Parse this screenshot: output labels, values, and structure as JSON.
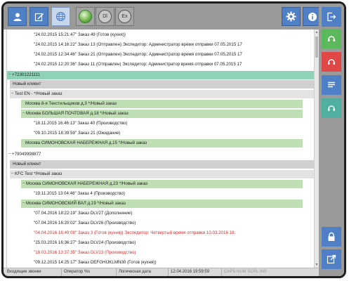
{
  "toolbar": {
    "badge_dl": "Dl",
    "badge_ex": "Ex"
  },
  "colors": {
    "accent_blue": "#4f7fc5",
    "green": "#5cb85c",
    "red": "#e04848",
    "teal": "#4fb0a0"
  },
  "rows": {
    "r0": "\"24.02.2015 15:21:47\"  Заказ 49 (Готов (кухня))",
    "r1": "\"24.02.2015 14:16:22\"  Заказ 13 (Отправлен) Экспедитор: Администратор время отправки 07.05.2015 17",
    "r2": "\"24.02.2015 12:34:46\"  Заказ 21 (Отправлен) Экспедитор: Администратор время отправки 07.05.2015 17",
    "r3": "\"24.02.2015 12:20:36\"  Заказ 11 (Отправлен) Экспедитор: Администратор время отправки 07.05.2015 17",
    "r4": "+72301221111",
    "r5": "Новый клиент",
    "r6": "Test EN -  */Новый заказ",
    "r7": "Москва 8-я Текстильщиков д.3   */Новый заказ",
    "r8": "Москва БОЛЬШАЯ ПОЧТОВАЯ д.18   */Новый заказ",
    "r9": "\"18.11.2015 16:46:13\"  Заказ 40 (Производство)",
    "r10": "\"09.10.2015 18:39:59\"  Заказ 21 (Ожидание)",
    "r11": "Москва СИМОНОВСКАЯ НАБЕРЕЖНАЯ д.15   */Новый заказ",
    "r12": "+79049998877",
    "r13": "Новый клиент",
    "r14": "KFC Test   */Новый заказ",
    "r15": "Москва СИМОНОВСКАЯ НАБЕРЕЖНАЯ д.23   */Новый заказ",
    "r16": "\"19.11.2015 13:04:46\"  Заказ 4 (Производство)",
    "r17": "Москва СИМОНОВСКИЙ ВАЛ д.19   */Новый заказ",
    "r18": "\"07.04.2016 18:22:19\"  Заказ DLV27 (Дополнение)",
    "r19": "\"07.04.2016 16:20:02\"  Заказ DLV26 (Производство)",
    "r20": "\"04.04.2016 16:40:08\"  Заказ 3 (Готов (кухня)) Экспедитор: Четвертый время отправки 10.03.2016 18:",
    "r21": "\"25.03.2016 16:36:27\"  Заказ DLV24 (Производство)",
    "r22": "\"18.03.2016 13:37:35\"  Заказ DLV23 (Производство)",
    "r23": "\"09.12.2015 14:25:17\"  Заказ DEFGHIJKLMN30 (Готов (кухня))"
  },
  "status": {
    "calls": "Входящие звонки",
    "operator": "Оператор %s",
    "logic_date_label": "Логическая дата",
    "datetime": "12.04.2016 19:59:59",
    "keys": "CAPS NUM SCRL INS"
  }
}
